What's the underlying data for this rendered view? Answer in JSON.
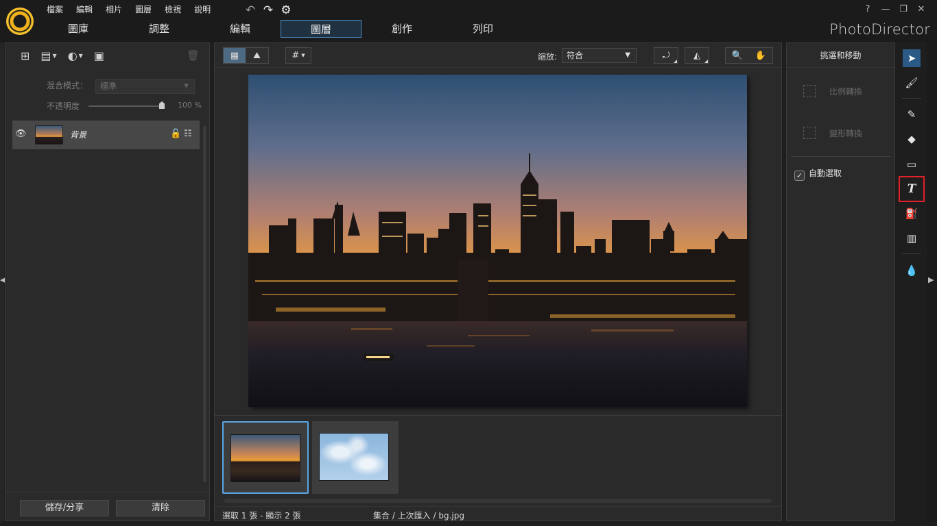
{
  "app": {
    "brand": "PhotoDirector",
    "menu": [
      "檔案",
      "編輯",
      "相片",
      "圖層",
      "檢視",
      "說明"
    ],
    "tabs": [
      {
        "label": "圖庫",
        "active": false
      },
      {
        "label": "調整",
        "active": false
      },
      {
        "label": "編輯",
        "active": false
      },
      {
        "label": "圖層",
        "active": true
      },
      {
        "label": "創作",
        "active": false
      },
      {
        "label": "列印",
        "active": false
      }
    ],
    "window_buttons": [
      "?",
      "—",
      "❐",
      "✕"
    ]
  },
  "layers_panel": {
    "blend_label": "混合模式：",
    "blend_value": "標準",
    "opacity_label": "不透明度",
    "opacity_value": "100 %",
    "opacity_level": 1.0,
    "layers": [
      {
        "name": "背景",
        "visible": true,
        "locked": true
      }
    ],
    "save_share_label": "儲存/分享",
    "clear_label": "清除"
  },
  "toolbar": {
    "zoom_label": "縮放:",
    "zoom_value": "符合"
  },
  "filmstrip": {
    "items": [
      {
        "name": "city-sunset",
        "selected": true
      },
      {
        "name": "bg.jpg",
        "selected": false
      }
    ]
  },
  "status": {
    "selection": "選取 1 張 - 顯示 2 張",
    "path": "集合 / 上次匯入 / bg.jpg"
  },
  "right_panel": {
    "title": "挑選和移動",
    "scale_label": "比例轉換",
    "transform_label": "變形轉換",
    "auto_select_label": "自動選取",
    "auto_select_checked": true
  },
  "tools": [
    {
      "name": "select-move",
      "selected": true
    },
    {
      "name": "smart-brush"
    },
    {
      "name": "brush"
    },
    {
      "name": "eraser"
    },
    {
      "name": "shape"
    },
    {
      "name": "text",
      "highlighted": true
    },
    {
      "name": "fill"
    },
    {
      "name": "gradient"
    },
    {
      "name": "dropper"
    }
  ],
  "colors": {
    "accent": "#4b90c8",
    "selected_tool": "#2c5a86",
    "highlight_box": "#e0202a",
    "logo": "#f2b21c"
  }
}
